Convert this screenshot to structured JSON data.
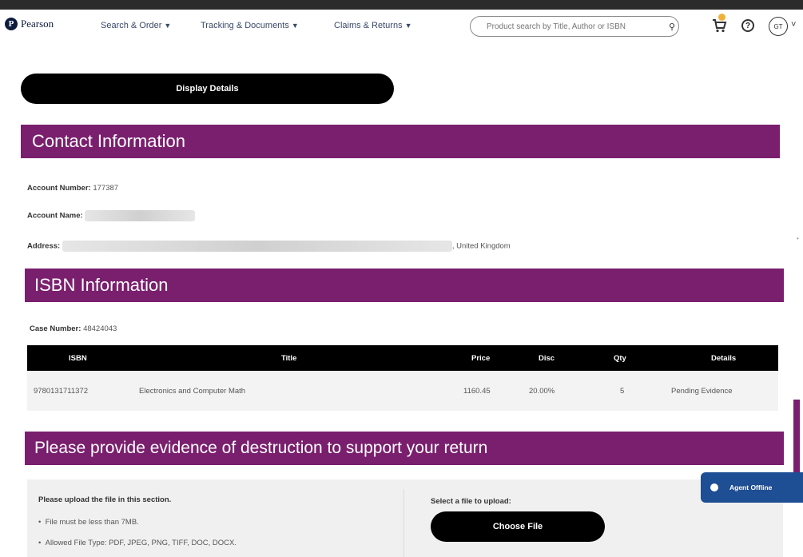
{
  "nav": {
    "logo_text": "Pearson",
    "menu": [
      "Search & Order",
      "Tracking & Documents",
      "Claims & Returns"
    ],
    "search_placeholder": "Product search by Title, Author or ISBN",
    "avatar_initials": "GT",
    "help_glyph": "?"
  },
  "display_button": "Display Details",
  "contact": {
    "heading": "Contact Information",
    "account_number_label": "Account Number:",
    "account_number": "177387",
    "account_name_label": "Account Name:",
    "address_label": "Address:",
    "address_suffix": ", United Kingdom"
  },
  "isbn": {
    "heading": "ISBN Information",
    "case_label": "Case Number:",
    "case_number": "48424043",
    "columns": [
      "ISBN",
      "Title",
      "Price",
      "Disc",
      "Qty",
      "Details"
    ],
    "rows": [
      {
        "isbn": "9780131711372",
        "title": "Electronics and Computer Math",
        "price": "1160.45",
        "disc": "20.00%",
        "qty": "5",
        "details": "Pending Evidence"
      }
    ]
  },
  "evidence": {
    "heading": "Please provide evidence of destruction to support your return",
    "instructions_title": "Please upload the file in this section.",
    "bullets": [
      "File must be less than 7MB.",
      "Allowed File Type: PDF, JPEG, PNG, TIFF, DOC, DOCX."
    ],
    "select_label": "Select a file to upload:",
    "choose_button": "Choose File"
  },
  "agent": {
    "label": "Agent Offline"
  },
  "colors": {
    "band": "#7a1f6e",
    "agent": "#1e4e93",
    "cart_badge": "#f0b13a"
  }
}
